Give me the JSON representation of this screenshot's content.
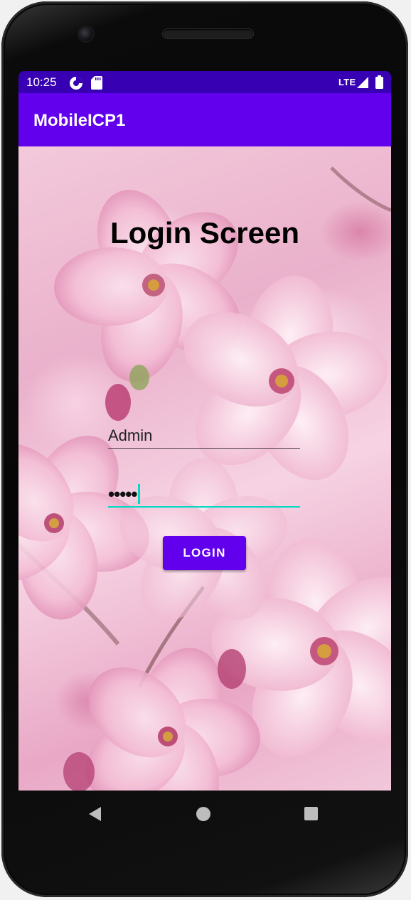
{
  "status_bar": {
    "time": "10:25",
    "network": "LTE",
    "icons": [
      "data-saver-icon",
      "sd-card-icon",
      "signal-icon",
      "battery-icon"
    ]
  },
  "app_bar": {
    "title": "MobileICP1"
  },
  "login": {
    "heading": "Login Screen",
    "username_value": "Admin",
    "password_masked": "•••••",
    "button_label": "LOGIN"
  },
  "nav_bar": {
    "icons": [
      "back-icon",
      "home-icon",
      "recents-icon"
    ]
  },
  "colors": {
    "status_bar": "#3700b3",
    "app_bar": "#6200ee",
    "button": "#6200ee",
    "focus_underline": "#03dac5"
  }
}
